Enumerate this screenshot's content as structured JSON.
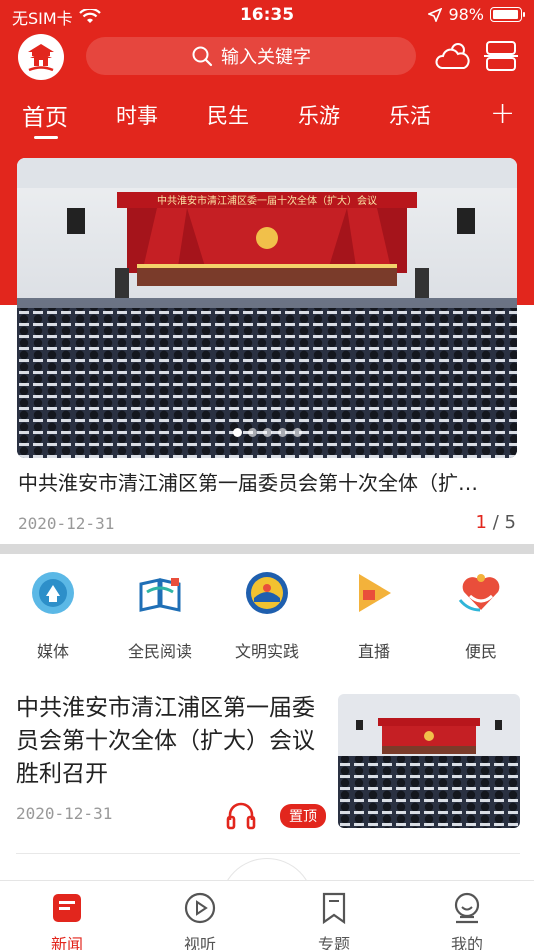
{
  "status_bar": {
    "carrier": "无SIM卡",
    "time": "16:35",
    "battery": "98%"
  },
  "search": {
    "placeholder": "输入关键字"
  },
  "tabs": [
    {
      "label": "首页",
      "active": true
    },
    {
      "label": "时事"
    },
    {
      "label": "民生"
    },
    {
      "label": "乐游"
    },
    {
      "label": "乐活"
    }
  ],
  "tab_add": "+",
  "banner": {
    "screen_text": "中共淮安市清江浦区委一届十次全体（扩大）会议",
    "title": "中共淮安市清江浦区第一届委员会第十次全体（扩…",
    "date": "2020-12-31",
    "page_current": "1",
    "page_sep": "/",
    "page_total": "5"
  },
  "quick_links": [
    {
      "label": "媒体",
      "icon": "media-icon"
    },
    {
      "label": "全民阅读",
      "icon": "reading-icon"
    },
    {
      "label": "文明实践",
      "icon": "civilization-icon"
    },
    {
      "label": "直播",
      "icon": "live-play-icon"
    },
    {
      "label": "便民",
      "icon": "convenience-icon"
    }
  ],
  "news": [
    {
      "title": "中共淮安市清江浦区第一届委员会第十次全体（扩大）会议胜利召开",
      "date": "2020-12-31",
      "badge": "置顶"
    }
  ],
  "bottom_nav": [
    {
      "label": "新闻",
      "icon": "news-icon",
      "active": true
    },
    {
      "label": "视听",
      "icon": "play-circle-icon"
    },
    {
      "label": "专题",
      "icon": "bookmark-icon"
    },
    {
      "label": "我的",
      "icon": "profile-icon"
    }
  ],
  "colors": {
    "brand_red": "#e2261d"
  }
}
